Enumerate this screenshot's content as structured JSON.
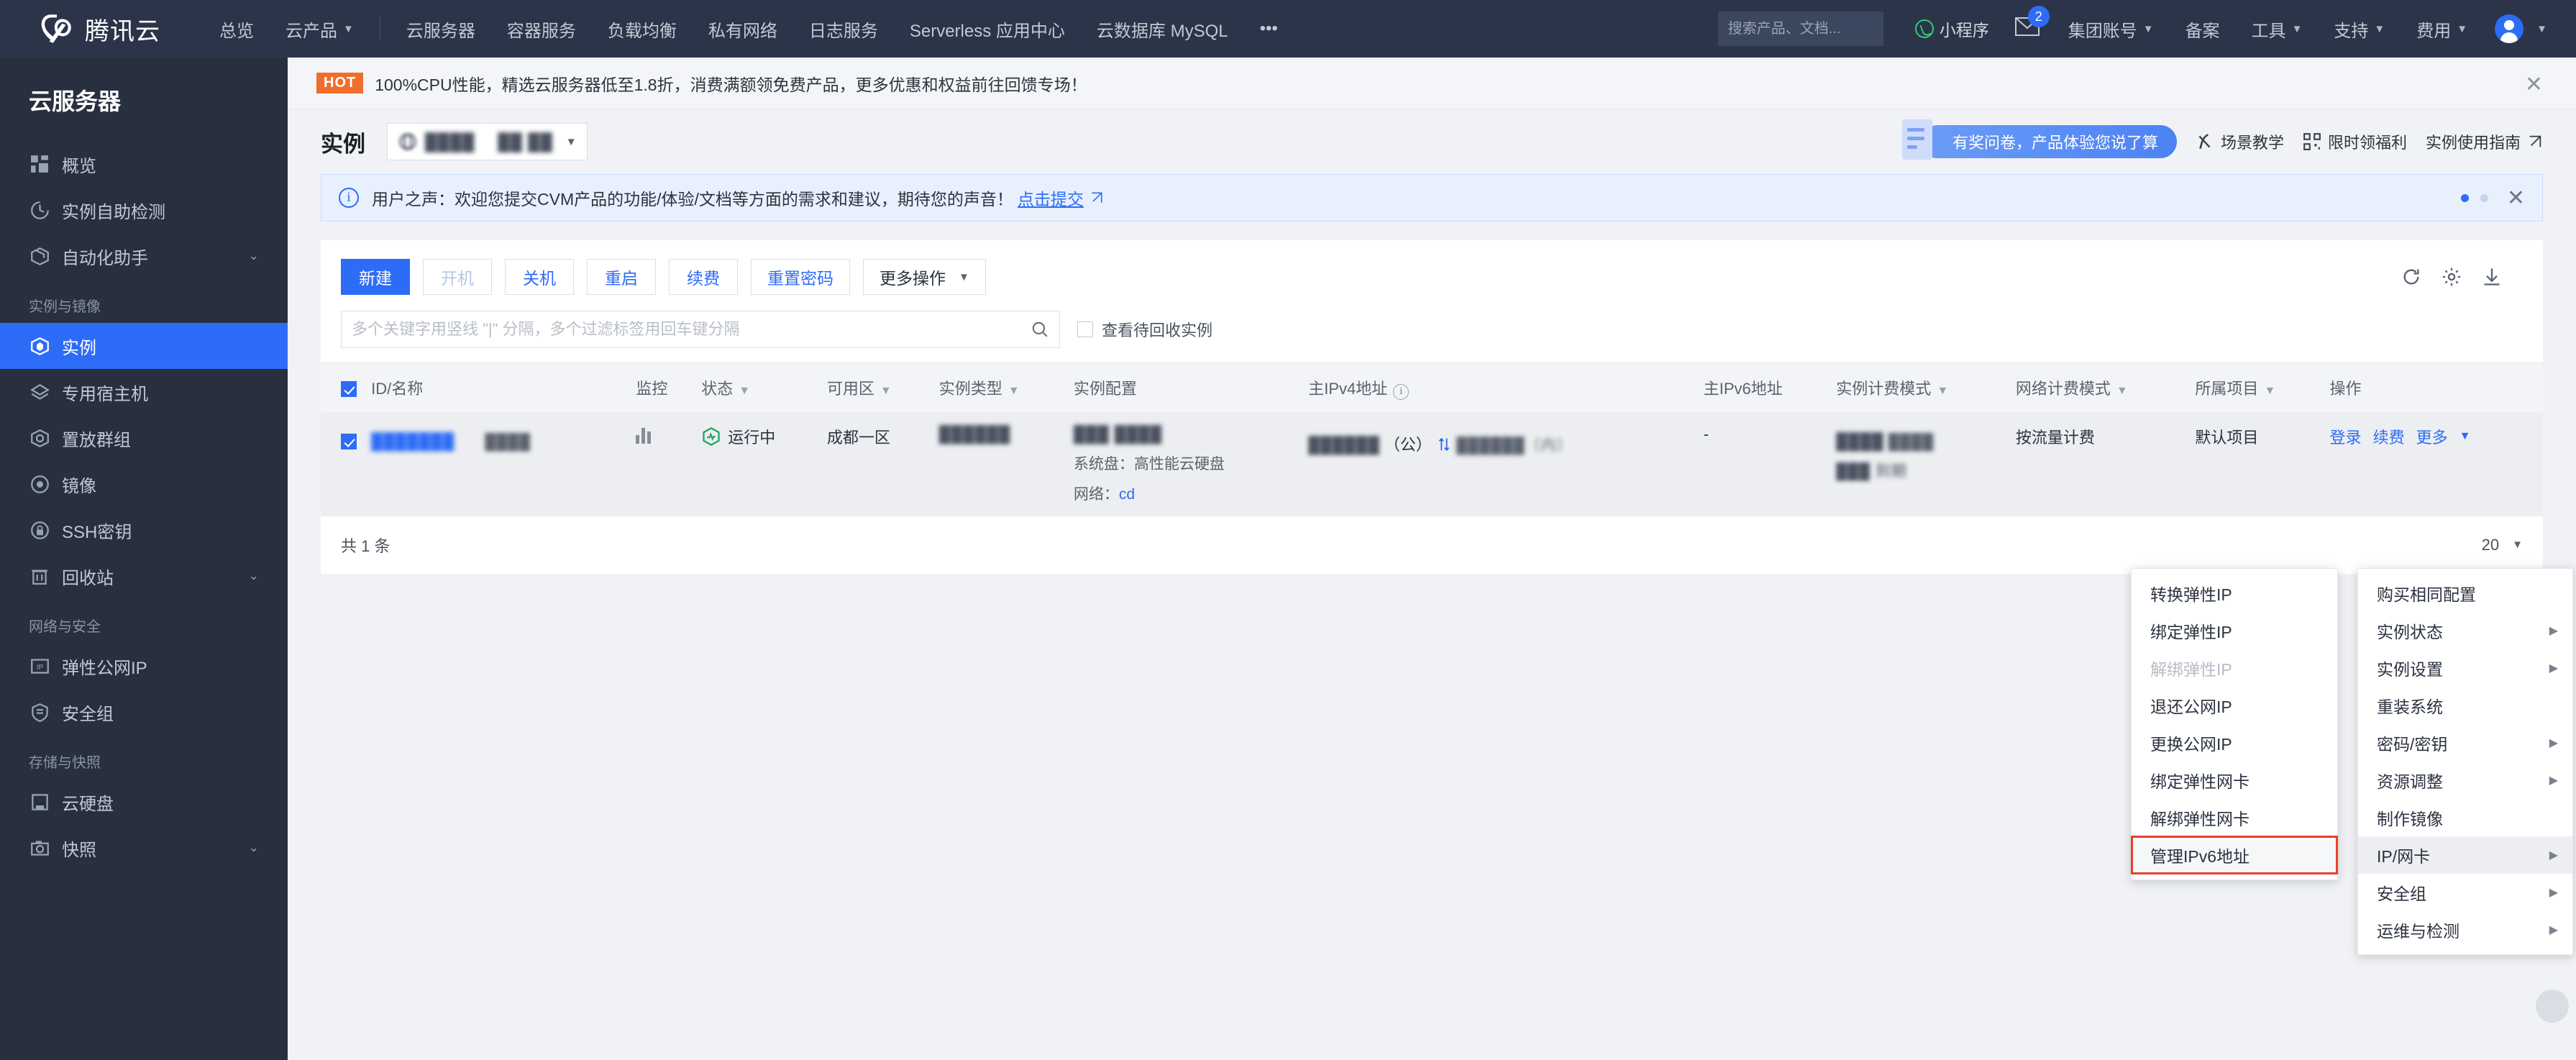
{
  "topnav": {
    "brand": "腾讯云",
    "items": [
      {
        "label": "总览",
        "caret": false
      },
      {
        "label": "云产品",
        "caret": true
      },
      {
        "label": "云服务器",
        "caret": false
      },
      {
        "label": "容器服务",
        "caret": false
      },
      {
        "label": "负载均衡",
        "caret": false
      },
      {
        "label": "私有网络",
        "caret": false
      },
      {
        "label": "日志服务",
        "caret": false
      },
      {
        "label": "Serverless 应用中心",
        "caret": false
      },
      {
        "label": "云数据库 MySQL",
        "caret": false
      },
      {
        "label": "•••",
        "caret": false
      }
    ],
    "search_placeholder": "搜索产品、文档...",
    "mini_program": "小程序",
    "mail_badge": "2",
    "right_items": [
      {
        "label": "集团账号",
        "caret": true
      },
      {
        "label": "备案",
        "caret": false
      },
      {
        "label": "工具",
        "caret": true
      },
      {
        "label": "支持",
        "caret": true
      },
      {
        "label": "费用",
        "caret": true
      }
    ]
  },
  "sidebar": {
    "title": "云服务器",
    "items": [
      {
        "label": "概览",
        "icon": "grid-icon",
        "type": "item",
        "active": false,
        "chevron": false
      },
      {
        "label": "实例自助检测",
        "icon": "gauge-icon",
        "type": "item",
        "active": false,
        "chevron": false
      },
      {
        "label": "自动化助手",
        "icon": "box-icon",
        "type": "item",
        "active": false,
        "chevron": true
      },
      {
        "label": "实例与镜像",
        "type": "group"
      },
      {
        "label": "实例",
        "icon": "cube-icon",
        "type": "item",
        "active": true,
        "chevron": false
      },
      {
        "label": "专用宿主机",
        "icon": "layers-icon",
        "type": "item",
        "active": false,
        "chevron": false
      },
      {
        "label": "置放群组",
        "icon": "hexagon-icon",
        "type": "item",
        "active": false,
        "chevron": false
      },
      {
        "label": "镜像",
        "icon": "circle-target-icon",
        "type": "item",
        "active": false,
        "chevron": false
      },
      {
        "label": "SSH密钥",
        "icon": "key-lock-icon",
        "type": "item",
        "active": false,
        "chevron": false
      },
      {
        "label": "回收站",
        "icon": "trash-icon",
        "type": "item",
        "active": false,
        "chevron": true
      },
      {
        "label": "网络与安全",
        "type": "group"
      },
      {
        "label": "弹性公网IP",
        "icon": "ip-icon",
        "type": "item",
        "active": false,
        "chevron": false
      },
      {
        "label": "安全组",
        "icon": "shield-icon",
        "type": "item",
        "active": false,
        "chevron": false
      },
      {
        "label": "存储与快照",
        "type": "group"
      },
      {
        "label": "云硬盘",
        "icon": "disk-icon",
        "type": "item",
        "active": false,
        "chevron": false
      },
      {
        "label": "快照",
        "icon": "camera-icon",
        "type": "item",
        "active": false,
        "chevron": true
      }
    ]
  },
  "hot_banner": {
    "tag": "HOT",
    "text": "100%CPU性能，精选云服务器低至1.8折，消费满额领免费产品，更多优惠和权益前往回馈专场！",
    "close": "✕"
  },
  "page_head": {
    "title": "实例",
    "region_primary": "████",
    "region_secondary": "██ ██",
    "survey_text": "有奖问卷，产品体验您说了算",
    "links": [
      {
        "label": "场景教学",
        "icon": "play-teach-icon",
        "external": false
      },
      {
        "label": "限时领福利",
        "icon": "qr-gift-icon",
        "external": false
      },
      {
        "label": "实例使用指南",
        "icon": "external-link-icon",
        "external": true
      }
    ]
  },
  "notice": {
    "icon": "info-icon",
    "text": "用户之声：欢迎您提交CVM产品的功能/体验/文档等方面的需求和建议，期待您的声音！",
    "link": "点击提交",
    "external_icon": "external-link-icon",
    "close": "✕"
  },
  "toolbar": {
    "buttons": [
      {
        "label": "新建",
        "style": "primary"
      },
      {
        "label": "开机",
        "style": "disabled"
      },
      {
        "label": "关机",
        "style": "default"
      },
      {
        "label": "重启",
        "style": "default"
      },
      {
        "label": "续费",
        "style": "default"
      },
      {
        "label": "重置密码",
        "style": "default"
      },
      {
        "label": "更多操作",
        "style": "default",
        "caret": true
      }
    ],
    "icons": [
      {
        "name": "refresh-icon"
      },
      {
        "name": "gear-icon"
      },
      {
        "name": "download-icon"
      }
    ]
  },
  "filterbar": {
    "placeholder": "多个关键字用竖线 \"|\" 分隔，多个过滤标签用回车键分隔",
    "search_icon": "search-icon",
    "recycle_checkbox_label": "查看待回收实例",
    "recycle_checked": false
  },
  "table": {
    "select_all_checked": true,
    "columns": [
      {
        "label": "ID/名称",
        "filter": false,
        "info": false
      },
      {
        "label": "监控",
        "filter": false,
        "info": false
      },
      {
        "label": "状态",
        "filter": true,
        "info": false
      },
      {
        "label": "可用区",
        "filter": true,
        "info": false
      },
      {
        "label": "实例类型",
        "filter": true,
        "info": false
      },
      {
        "label": "实例配置",
        "filter": false,
        "info": false
      },
      {
        "label": "主IPv4地址",
        "filter": false,
        "info": true
      },
      {
        "label": "主IPv6地址",
        "filter": false,
        "info": false
      },
      {
        "label": "实例计费模式",
        "filter": true,
        "info": false
      },
      {
        "label": "网络计费模式",
        "filter": true,
        "info": false
      },
      {
        "label": "所属项目",
        "filter": true,
        "info": false
      },
      {
        "label": "操作",
        "filter": false,
        "info": false
      }
    ],
    "rows": [
      {
        "checked": true,
        "id": "███████",
        "name": "████",
        "monitor_icon": "bar-chart-icon",
        "status": "运行中",
        "status_icon": "running-icon",
        "zone": "成都一区",
        "instance_type": "██████",
        "config_main": "███ ████",
        "config_disk_label": "系统盘：",
        "config_disk_value": "高性能云硬盘",
        "config_net_label": "网络：",
        "config_net_value": "cd",
        "ipv4_line1": "██████",
        "ipv4_suffix": "（公）",
        "ipv4_copy_icon": "copy-icon",
        "ipv4_line2": "██████（内）",
        "ipv6": "-",
        "billing_mode": "████",
        "billing_line2": "████",
        "billing_line3": "███ 到期",
        "net_billing": "按流量计费",
        "project": "默认项目",
        "ops": [
          "登录",
          "续费",
          "更多"
        ],
        "ops_caret": "▼"
      }
    ],
    "footer_total": "共 1 条",
    "page_size": "20"
  },
  "menu_left": {
    "items": [
      {
        "label": "转换弹性IP",
        "disabled": false,
        "submenu": false,
        "highlight": false,
        "boxed": false
      },
      {
        "label": "绑定弹性IP",
        "disabled": false,
        "submenu": false,
        "highlight": false,
        "boxed": false
      },
      {
        "label": "解绑弹性IP",
        "disabled": true,
        "submenu": false,
        "highlight": false,
        "boxed": false
      },
      {
        "label": "退还公网IP",
        "disabled": false,
        "submenu": false,
        "highlight": false,
        "boxed": false
      },
      {
        "label": "更换公网IP",
        "disabled": false,
        "submenu": false,
        "highlight": false,
        "boxed": false
      },
      {
        "label": "绑定弹性网卡",
        "disabled": false,
        "submenu": false,
        "highlight": false,
        "boxed": false
      },
      {
        "label": "解绑弹性网卡",
        "disabled": false,
        "submenu": false,
        "highlight": false,
        "boxed": false
      },
      {
        "label": "管理IPv6地址",
        "disabled": false,
        "submenu": false,
        "highlight": false,
        "boxed": true
      }
    ]
  },
  "menu_right": {
    "items": [
      {
        "label": "购买相同配置",
        "submenu": false,
        "highlight": false
      },
      {
        "label": "实例状态",
        "submenu": true,
        "highlight": false
      },
      {
        "label": "实例设置",
        "submenu": true,
        "highlight": false
      },
      {
        "label": "重装系统",
        "submenu": false,
        "highlight": false
      },
      {
        "label": "密码/密钥",
        "submenu": true,
        "highlight": false
      },
      {
        "label": "资源调整",
        "submenu": true,
        "highlight": false
      },
      {
        "label": "制作镜像",
        "submenu": false,
        "highlight": false
      },
      {
        "label": "IP/网卡",
        "submenu": true,
        "highlight": true
      },
      {
        "label": "安全组",
        "submenu": true,
        "highlight": false
      },
      {
        "label": "运维与检测",
        "submenu": true,
        "highlight": false
      }
    ],
    "arrow_glyph": "▶"
  }
}
